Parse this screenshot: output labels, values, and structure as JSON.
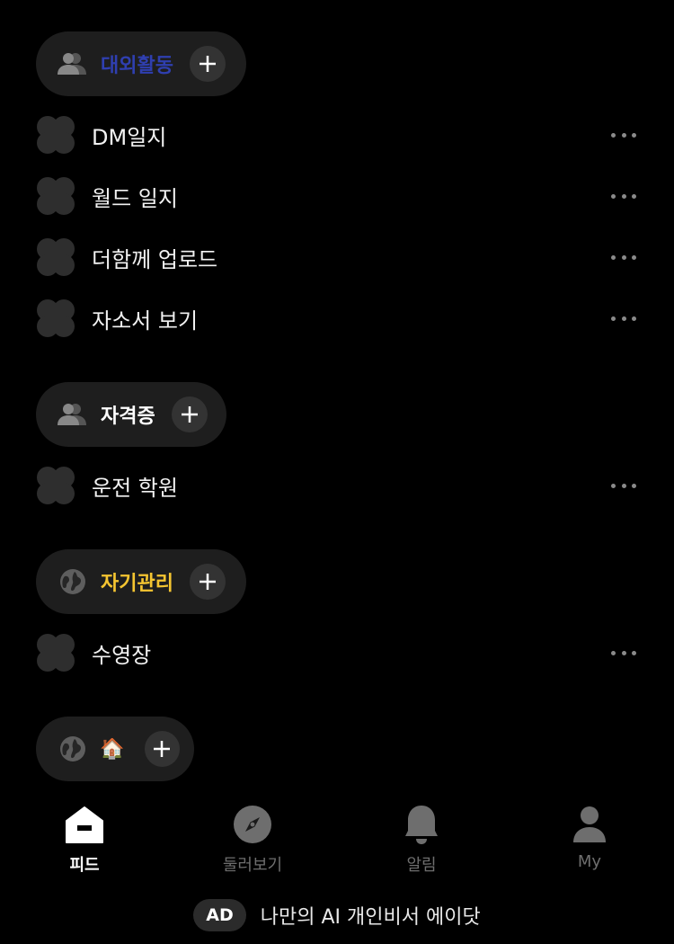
{
  "groups": [
    {
      "name": "대외활동",
      "color": "#2f3fb0",
      "icon": "people-icon",
      "items": [
        {
          "label": "DM일지"
        },
        {
          "label": "월드 일지"
        },
        {
          "label": "더함께 업로드"
        },
        {
          "label": "자소서 보기"
        }
      ]
    },
    {
      "name": "자격증",
      "color": "#ffffff",
      "icon": "people-icon",
      "items": [
        {
          "label": "운전 학원"
        }
      ]
    },
    {
      "name": "자기관리",
      "color": "#f5c531",
      "icon": "globe-icon",
      "items": [
        {
          "label": "수영장"
        }
      ]
    },
    {
      "name": "🏠",
      "icon": "globe-icon",
      "items": []
    }
  ],
  "tabbar": {
    "tabs": [
      {
        "label": "피드",
        "icon": "home-icon",
        "active": true
      },
      {
        "label": "둘러보기",
        "icon": "compass-icon",
        "active": false
      },
      {
        "label": "알림",
        "icon": "bell-icon",
        "active": false
      },
      {
        "label": "My",
        "icon": "user-icon",
        "active": false
      }
    ]
  },
  "ad": {
    "badge": "AD",
    "text": "나만의 AI 개인비서 에이닷"
  },
  "colors": {
    "background": "#000000",
    "pill": "#1e1e1e",
    "add_button": "#333333",
    "item_icon": "#2e2e2e",
    "inactive": "#6e6e6e"
  }
}
